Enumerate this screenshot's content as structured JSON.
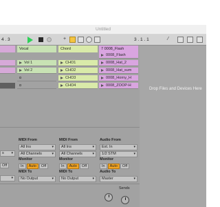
{
  "window": {
    "title": "Untitled"
  },
  "transport": {
    "position_left": "4 . 3",
    "position_right": "3 .  1 .  1",
    "follow_icon": "+",
    "draw_icon": "⁄",
    "colors": {
      "play": "#2fd158",
      "arrange_record": "#f5c542"
    }
  },
  "tracks": [
    {
      "name": "",
      "color": "#d6a9d8",
      "clips": [
        {
          "label": "",
          "color": "#d6a9d8"
        },
        {
          "label": "",
          "color": "#d6a9d8"
        },
        {
          "label": "",
          "color": "#5f5f5f"
        }
      ]
    },
    {
      "name": "Vocal",
      "color": "#c8e2b4",
      "clips": [
        {
          "label": "Vol 1",
          "color": "#c8e2b4"
        },
        {
          "label": "Vol 2",
          "color": "#c8e2b4"
        },
        {
          "label": "",
          "color": ""
        },
        {
          "label": "",
          "color": ""
        }
      ]
    },
    {
      "name": "Chord",
      "color": "#d9eaa9",
      "clips": [
        {
          "label": "CHO1",
          "color": "#d9eaa9"
        },
        {
          "label": "CHO2",
          "color": "#d9eaa9"
        },
        {
          "label": "CHO3",
          "color": "#d9eaa9"
        },
        {
          "label": "CHO4",
          "color": "#d9eaa9"
        }
      ]
    },
    {
      "name": "7 0008_Flash",
      "color": "#d9a5e0",
      "clips": [
        {
          "label": "0008_Flash",
          "color": "#d9a5e0"
        },
        {
          "label": "0008_Hat_2",
          "color": "#d9a5e0"
        },
        {
          "label": "0008_Hat_sum",
          "color": "#d9a5e0"
        },
        {
          "label": "0008_Horny_H",
          "color": "#d9a5e0"
        },
        {
          "label": "0008_ZOOP-H",
          "color": "#d9a5e0"
        }
      ]
    }
  ],
  "dropzone": {
    "text": "Drop Files and Devices Here"
  },
  "io": {
    "col0": {
      "channel": "s",
      "monitor": [
        "In",
        "Auto",
        "Off"
      ],
      "out": ""
    },
    "col1": {
      "from_label": "MIDI From",
      "from": "All Ins",
      "channel": "All Channels",
      "monitor_label": "Monitor",
      "monitor": [
        "In",
        "Auto",
        "Off"
      ],
      "to_label": "MIDI To",
      "to": "No Output"
    },
    "col2": {
      "from_label": "MIDI From",
      "from": "All Ins",
      "channel": "All Channels",
      "monitor_label": "Monitor",
      "monitor": [
        "In",
        "Auto",
        "Off"
      ],
      "to_label": "MIDI To",
      "to": "No Output"
    },
    "col3": {
      "from_label": "Audio From",
      "from": "Ext. In",
      "channel": "1/2 STM",
      "monitor_label": "Monitor",
      "monitor": [
        "In",
        "Auto",
        "Off"
      ],
      "to_label": "Audio To",
      "to": "Master"
    }
  },
  "sends": {
    "label": "Sends"
  }
}
